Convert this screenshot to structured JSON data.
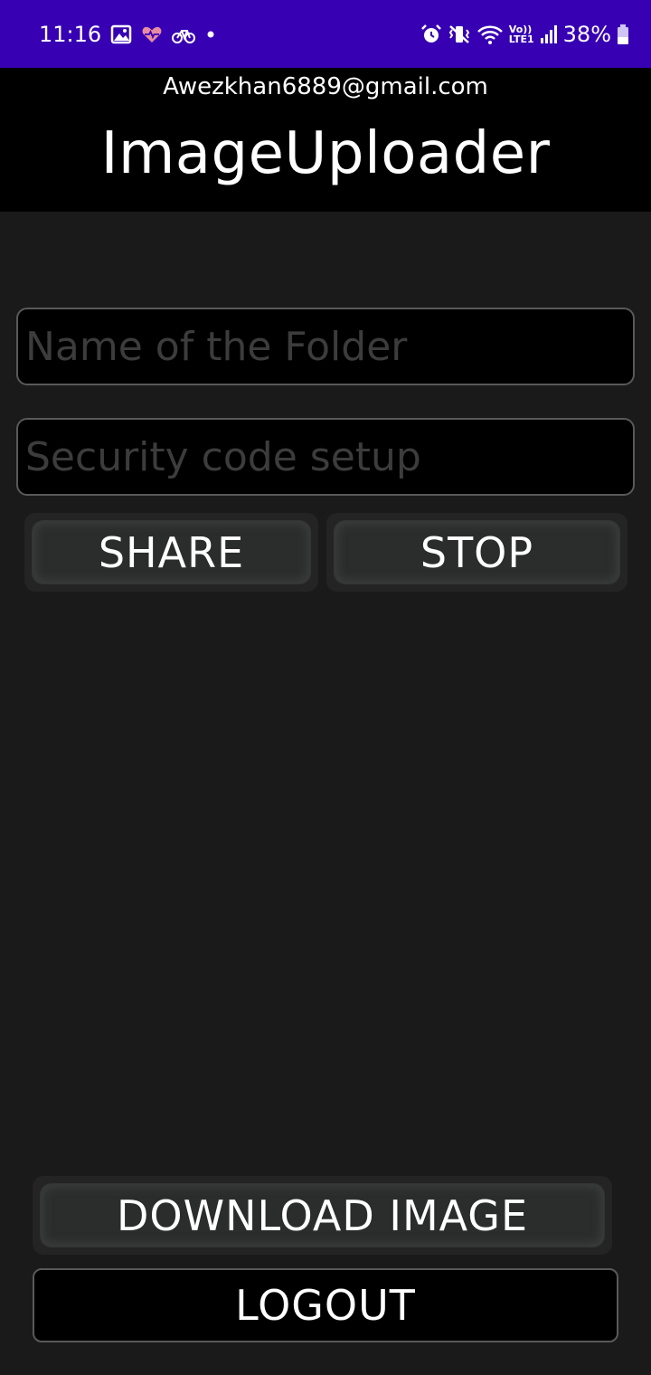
{
  "status_bar": {
    "time": "11:16",
    "battery_percent": "38%",
    "network_label_top": "Vo))",
    "network_label_bottom": "LTE1",
    "icons": [
      "gallery-icon",
      "health-icon",
      "bike-icon",
      "notification-dot-icon",
      "alarm-icon",
      "vibrate-icon",
      "wifi-icon",
      "volte-icon",
      "signal-icon",
      "battery-icon"
    ],
    "bar_color": "#3700b3",
    "battery_level": 0.38
  },
  "header": {
    "email": "Awezkhan6889@gmail.com",
    "title": "ImageUploader"
  },
  "form": {
    "folder_value": "",
    "folder_placeholder": "Name of the Folder",
    "code_value": "",
    "code_placeholder": "Security code setup"
  },
  "buttons": {
    "share": "SHARE",
    "stop": "STOP",
    "download": "DOWNLOAD IMAGE",
    "logout": "LOGOUT"
  },
  "colors": {
    "background": "#1b1a1a",
    "header_background": "#000000",
    "field_border": "#595959"
  }
}
